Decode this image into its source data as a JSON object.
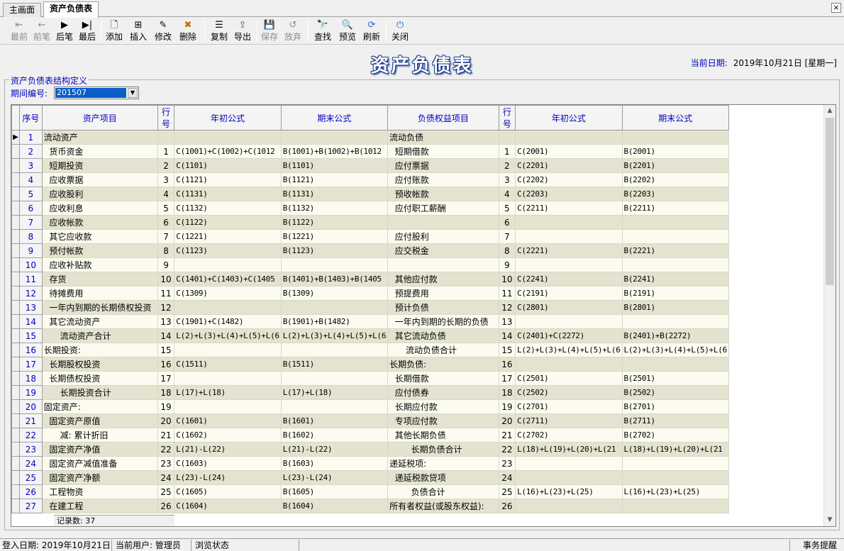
{
  "tabs": [
    {
      "label": "主画面",
      "active": false
    },
    {
      "label": "资产负债表",
      "active": true
    }
  ],
  "window_close": "×",
  "toolbar": {
    "first": "最前",
    "prev": "前笔",
    "next": "后笔",
    "last": "最后",
    "add": "添加",
    "insert": "插入",
    "edit": "修改",
    "delete": "删除",
    "copy": "复制",
    "export": "导出",
    "save": "保存",
    "discard": "放弃",
    "find": "查找",
    "preview": "预览",
    "refresh": "刷新",
    "close": "关闭"
  },
  "icons": {
    "first": "⇤",
    "prev": "←",
    "next": "▶",
    "last": "▶|",
    "add": "🗋",
    "insert": "⊞",
    "edit": "✎",
    "delete": "✖",
    "copy": "☰",
    "export": "⇪",
    "save": "💾",
    "discard": "↺",
    "find": "🔭",
    "preview": "🔍",
    "refresh": "⟳",
    "close": "⏻"
  },
  "page_title": "资产负债表",
  "current_date": {
    "label": "当前日期:",
    "value": "2019年10月21日 [星期一]"
  },
  "group": {
    "legend": "资产负债表结构定义",
    "period_label": "期间编号:",
    "period_value": "201507"
  },
  "grid": {
    "columns": [
      "序号",
      "资产项目",
      "行号",
      "年初公式",
      "期末公式",
      "负债权益项目",
      "行号",
      "年初公式",
      "期末公式"
    ],
    "current_row_marker": "▶",
    "rows": [
      [
        "1",
        "流动资产",
        "",
        "",
        "",
        "流动负债",
        "",
        "",
        ""
      ],
      [
        "2",
        "  货币资金",
        "1",
        "C(1001)+C(1002)+C(1012",
        "B(1001)+B(1002)+B(1012",
        "  短期借款",
        "1",
        "C(2001)",
        "B(2001)"
      ],
      [
        "3",
        "  短期投资",
        "2",
        "C(1101)",
        "B(1101)",
        "  应付票据",
        "2",
        "C(2201)",
        "B(2201)"
      ],
      [
        "4",
        "  应收票据",
        "3",
        "C(1121)",
        "B(1121)",
        "  应付账款",
        "3",
        "C(2202)",
        "B(2202)"
      ],
      [
        "5",
        "  应收股利",
        "4",
        "C(1131)",
        "B(1131)",
        "  预收帐款",
        "4",
        "C(2203)",
        "B(2203)"
      ],
      [
        "6",
        "  应收利息",
        "5",
        "C(1132)",
        "B(1132)",
        "  应付职工薪酬",
        "5",
        "C(2211)",
        "B(2211)"
      ],
      [
        "7",
        "  应收帐款",
        "6",
        "C(1122)",
        "B(1122)",
        "",
        "6",
        "",
        ""
      ],
      [
        "8",
        "  其它应收款",
        "7",
        "C(1221)",
        "B(1221)",
        "  应付股利",
        "7",
        "",
        ""
      ],
      [
        "9",
        "  预付帐款",
        "8",
        "C(1123)",
        "B(1123)",
        "  应交税金",
        "8",
        "C(2221)",
        "B(2221)"
      ],
      [
        "10",
        "  应收补贴款",
        "9",
        "",
        "",
        "",
        "9",
        "",
        ""
      ],
      [
        "11",
        "  存货",
        "10",
        "C(1401)+C(1403)+C(1405",
        "B(1401)+B(1403)+B(1405",
        "  其他应付款",
        "10",
        "C(2241)",
        "B(2241)"
      ],
      [
        "12",
        "  待摊费用",
        "11",
        "C(1309)",
        "B(1309)",
        "  预提费用",
        "11",
        "C(2191)",
        "B(2191)"
      ],
      [
        "13",
        "  一年内到期的长期债权投资",
        "12",
        "",
        "",
        "  预计负债",
        "12",
        "C(2801)",
        "B(2801)"
      ],
      [
        "14",
        "  其它流动资产",
        "13",
        "C(1901)+C(1482)",
        "B(1901)+B(1482)",
        "  一年内到期的长期的负债",
        "13",
        "",
        ""
      ],
      [
        "15",
        "      流动资产合计",
        "14",
        "L(2)+L(3)+L(4)+L(5)+L(6",
        "L(2)+L(3)+L(4)+L(5)+L(6",
        "  其它流动负债",
        "14",
        "C(2401)+C(2272)",
        "B(2401)+B(2272)"
      ],
      [
        "16",
        "长期投资:",
        "15",
        "",
        "",
        "      流动负债合计",
        "15",
        "L(2)+L(3)+L(4)+L(5)+L(6",
        "L(2)+L(3)+L(4)+L(5)+L(6"
      ],
      [
        "17",
        "  长期股权投资",
        "16",
        "C(1511)",
        "B(1511)",
        "长期负债:",
        "16",
        "",
        ""
      ],
      [
        "18",
        "  长期债权投资",
        "17",
        "",
        "",
        "  长期借款",
        "17",
        "C(2501)",
        "B(2501)"
      ],
      [
        "19",
        "      长期投资合计",
        "18",
        "L(17)+L(18)",
        "L(17)+L(18)",
        "  应付债券",
        "18",
        "C(2502)",
        "B(2502)"
      ],
      [
        "20",
        "固定资产:",
        "19",
        "",
        "",
        "  长期应付款",
        "19",
        "C(2701)",
        "B(2701)"
      ],
      [
        "21",
        "  固定资产原值",
        "20",
        "C(1601)",
        "B(1601)",
        "  专项应付款",
        "20",
        "C(2711)",
        "B(2711)"
      ],
      [
        "22",
        "      减: 累计折旧",
        "21",
        "C(1602)",
        "B(1602)",
        "  其他长期负债",
        "21",
        "C(2702)",
        "B(2702)"
      ],
      [
        "23",
        "  固定资产净值",
        "22",
        "L(21)-L(22)",
        "L(21)-L(22)",
        "        长期负债合计",
        "22",
        "L(18)+L(19)+L(20)+L(21",
        "L(18)+L(19)+L(20)+L(21"
      ],
      [
        "24",
        "  固定资产减值准备",
        "23",
        "C(1603)",
        "B(1603)",
        "递延税项:",
        "23",
        "",
        ""
      ],
      [
        "25",
        "  固定资产净额",
        "24",
        "L(23)-L(24)",
        "L(23)-L(24)",
        "  递延税款贷项",
        "24",
        "",
        ""
      ],
      [
        "26",
        "  工程物资",
        "25",
        "C(1605)",
        "B(1605)",
        "        负债合计",
        "25",
        "L(16)+L(23)+L(25)",
        "L(16)+L(23)+L(25)"
      ],
      [
        "27",
        "  在建工程",
        "26",
        "C(1604)",
        "B(1604)",
        "所有者权益(或股东权益):",
        "26",
        "",
        ""
      ]
    ],
    "record_count": "记录数: 37"
  },
  "scrollbar": {
    "up": "▲",
    "down": "▼"
  },
  "status": {
    "login_date": "登入日期: 2019年10月21日",
    "current_user": "当前用户: 管理员",
    "mode": "浏览状态",
    "reminder": "事务提醒"
  }
}
